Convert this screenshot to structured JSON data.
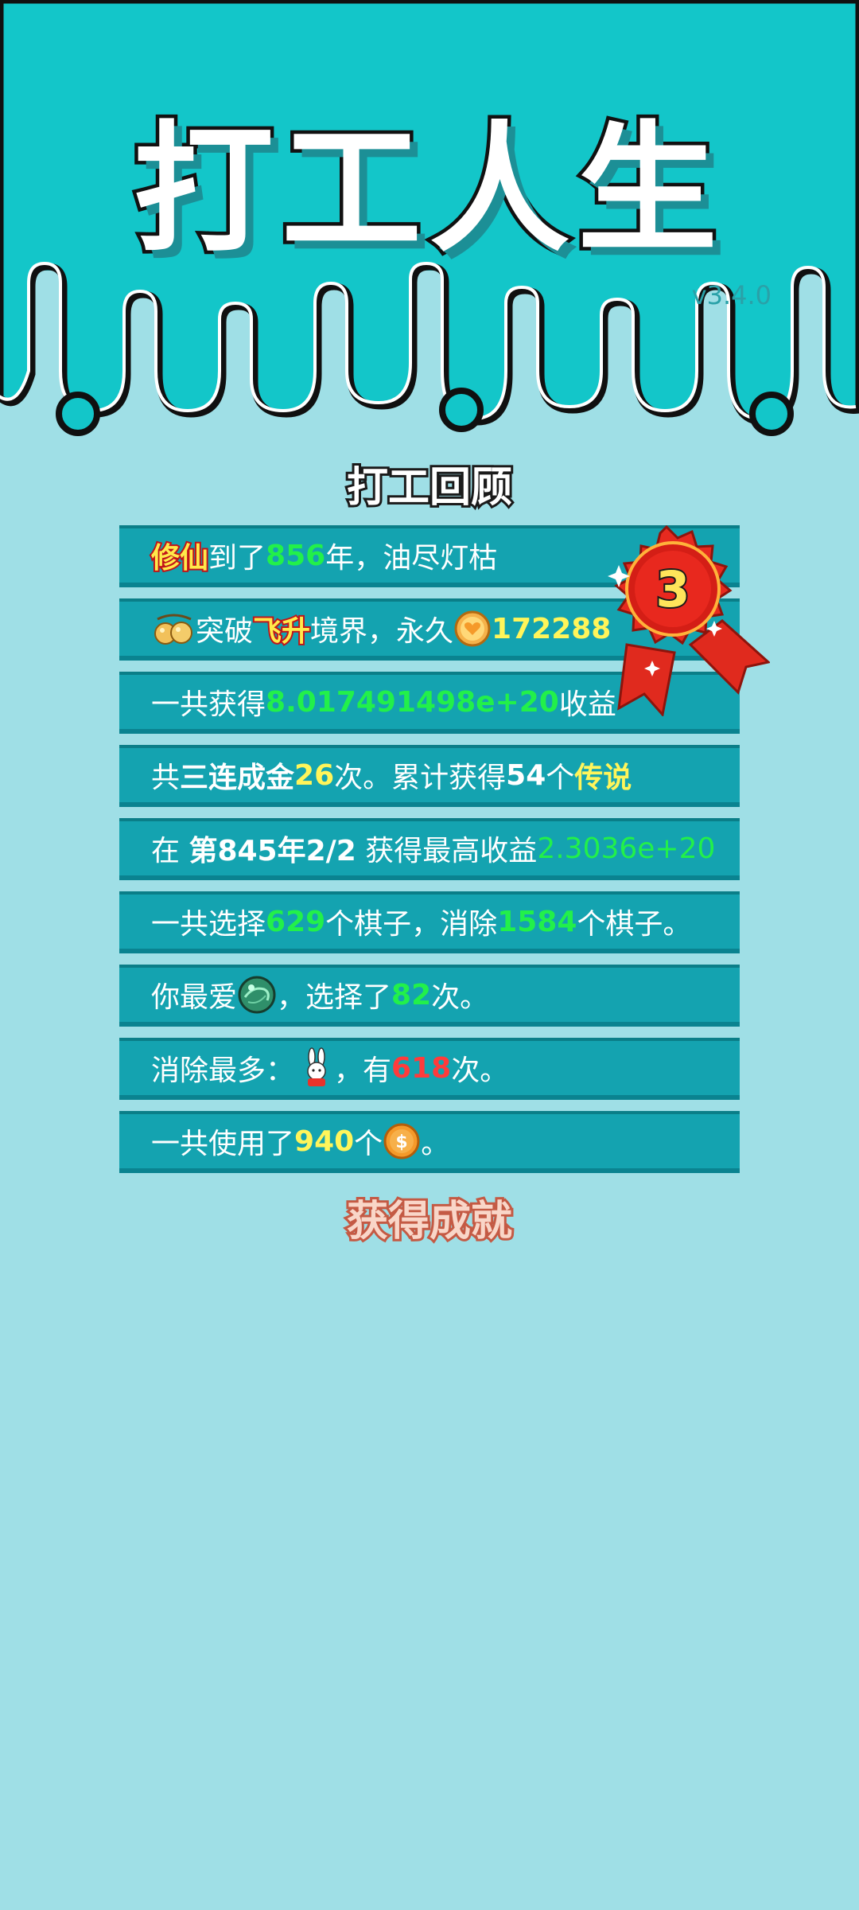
{
  "header": {
    "title": "打工人生",
    "version": "v3.4.0"
  },
  "review": {
    "section_title": "打工回顾",
    "rank": "3",
    "rows": {
      "r1": {
        "tag": "修仙",
        "t1": "到了",
        "years": "856",
        "t2": "年，油尽灯枯"
      },
      "r2": {
        "t1": "突破",
        "tag": "飞升",
        "t2": "境界，永久",
        "value": "172288"
      },
      "r3": {
        "t1": "一共获得",
        "value": "8.017491498e+20",
        "t2": "收益"
      },
      "r4": {
        "t1": "共",
        "combo": "三连成金",
        "count": "26",
        "t2": "次。累计获得",
        "legend_count": "54",
        "t3": "个",
        "legend": "传说"
      },
      "r5": {
        "t1": "在 ",
        "when": "第845年2/2",
        "t2": " 获得最高收益",
        "value": "2.3036e+20"
      },
      "r6": {
        "t1": "一共选择",
        "chosen": "629",
        "t2": "个棋子，消除",
        "cleared": "1584",
        "t3": "个棋子。"
      },
      "r7": {
        "t1": "你最爱",
        "t2": "，选择了",
        "count": "82",
        "t3": "次。"
      },
      "r8": {
        "t1": "消除最多：",
        "t2": "，有",
        "count": "618",
        "t3": "次。"
      },
      "r9": {
        "t1": "一共使用了",
        "count": "940",
        "t2": "个",
        "t3": "。"
      }
    }
  },
  "achievements": {
    "heading": "获得成就"
  },
  "colors": {
    "header_bg": "#13c6c9",
    "page_bg": "#9fdfe6",
    "row_bg": "#14a3b0",
    "highlight_green": "#22f04a",
    "highlight_yellow": "#fff55a",
    "highlight_red": "#ff3b3b"
  },
  "icons": {
    "r2": "twin-peaches-icon",
    "r2_value": "gold-heart-coin-icon",
    "r7": "green-jade-orb-icon",
    "r8": "rabbit-icon",
    "r9": "dollar-coin-icon",
    "badge": "red-ribbon-rosette-icon"
  }
}
